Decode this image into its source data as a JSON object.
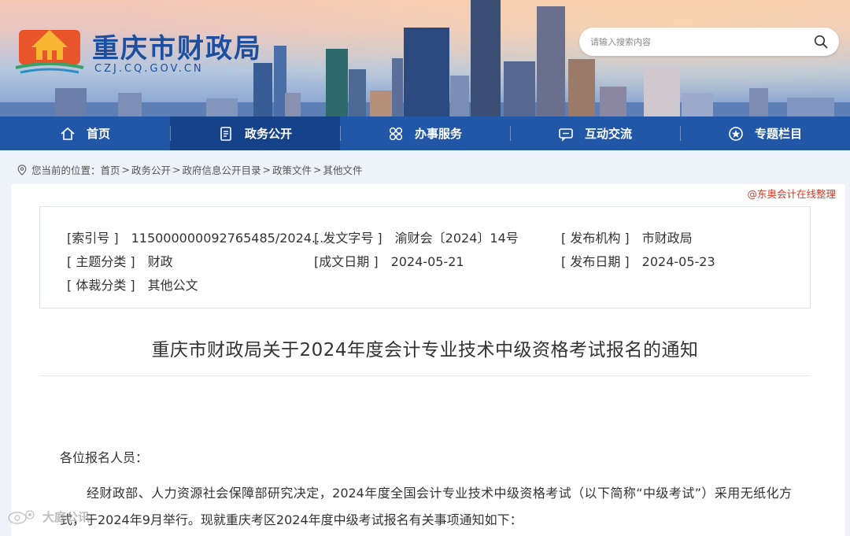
{
  "header": {
    "site_title": "重庆市财政局",
    "site_url": "CZJ.CQ.GOV.CN",
    "search_placeholder": "请输入搜索内容"
  },
  "nav": [
    {
      "label": "首页",
      "icon": "home-icon"
    },
    {
      "label": "政务公开",
      "icon": "document-icon"
    },
    {
      "label": "办事服务",
      "icon": "grid-icon"
    },
    {
      "label": "互动交流",
      "icon": "chat-icon"
    },
    {
      "label": "专题栏目",
      "icon": "star-icon"
    }
  ],
  "breadcrumb": {
    "prefix": "您当前的位置：",
    "items": [
      "首页",
      "政务公开",
      "政府信息公开目录",
      "政策文件",
      "其他文件"
    ]
  },
  "watermark_top": "@东奥会计在线整理",
  "meta": {
    "index_no": {
      "label": "[索引号 ]",
      "value": "115000000092765485/2024..."
    },
    "doc_no": {
      "label": "[ 发文字号 ]",
      "value": "渝财会〔2024〕14号"
    },
    "issuer": {
      "label": "[ 发布机构 ]",
      "value": "市财政局"
    },
    "topic": {
      "label": "[ 主题分类 ]",
      "value": "财政"
    },
    "written_date": {
      "label": "[成文日期 ]",
      "value": "2024-05-21"
    },
    "publish_date": {
      "label": "[ 发布日期 ]",
      "value": "2024-05-23"
    },
    "genre": {
      "label": "[ 体裁分类 ]",
      "value": "其他公文"
    }
  },
  "doc": {
    "title": "重庆市财政局关于2024年度会计专业技术中级资格考试报名的通知",
    "salutation": "各位报名人员：",
    "paragraph1": "经财政部、人力资源社会保障部研究决定，2024年度全国会计专业技术中级资格考试（以下简称“中级考试”）采用无纸化方式，于2024年9月举行。现就重庆考区2024年度中级考试报名有关事项通知如下："
  },
  "bottom_watermark": "大庭公讯",
  "colors": {
    "nav_bg": "#2257a8",
    "nav_active": "#16428a",
    "title_blue": "#1c4fa0",
    "watermark_red": "#d23b2a"
  }
}
